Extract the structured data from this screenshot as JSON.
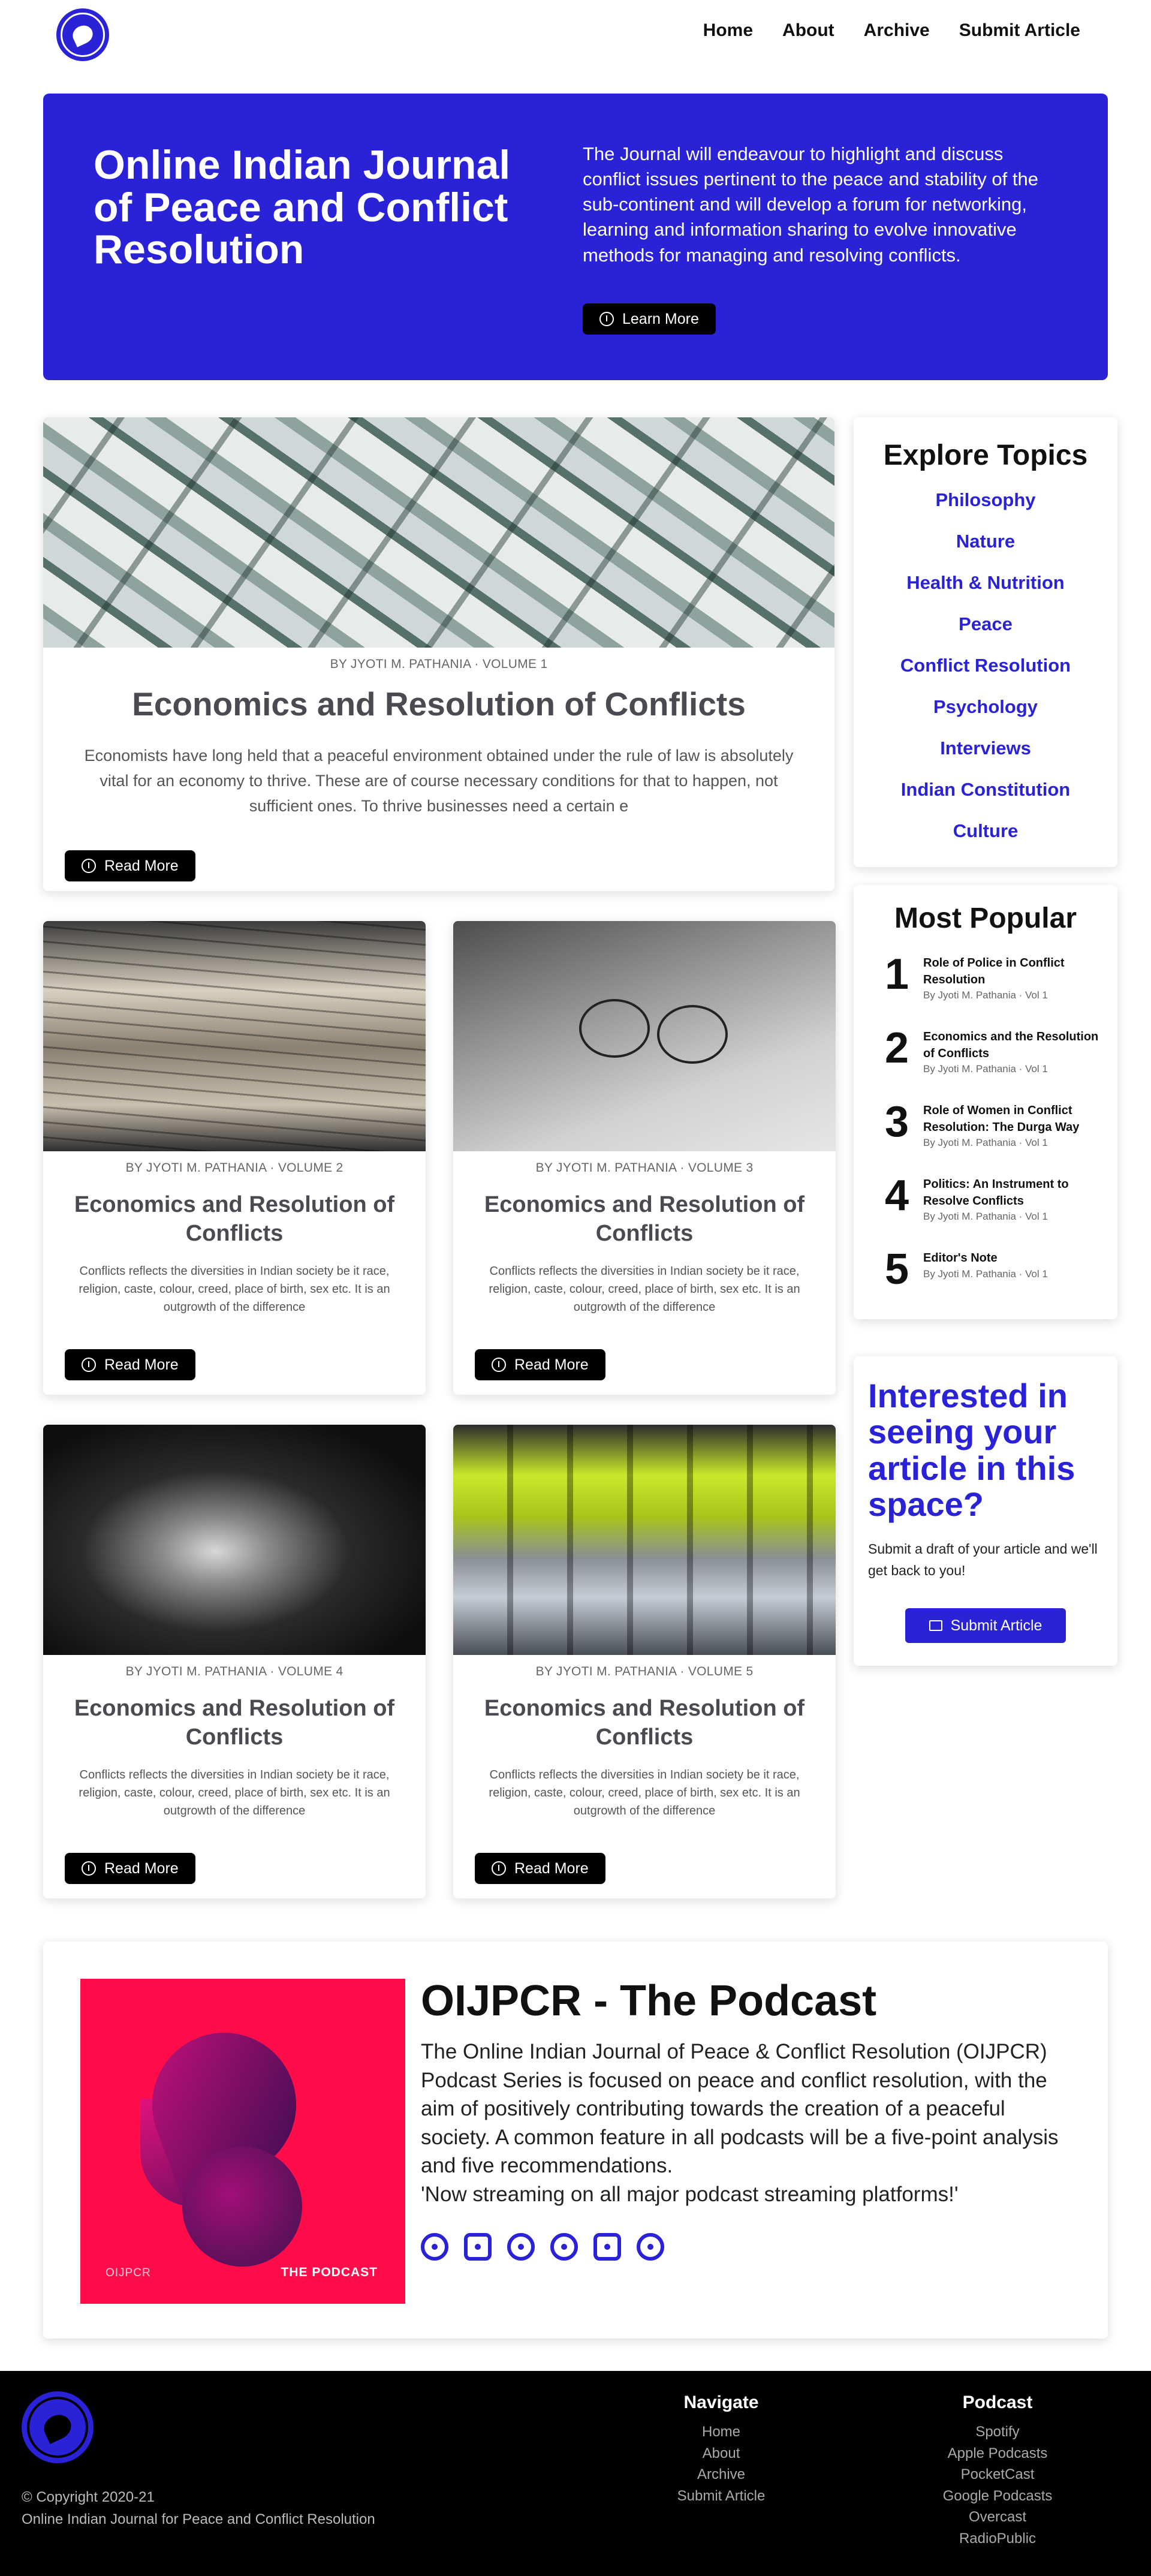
{
  "nav": {
    "items": [
      "Home",
      "About",
      "Archive",
      "Submit Article"
    ]
  },
  "hero": {
    "title": "Online Indian Journal of Peace and Conflict Resolution",
    "description": "The Journal will endeavour to highlight and discuss conflict issues pertinent to the peace and stability of the sub-continent and will develop a forum for networking, learning and information sharing to evolve innovative methods for managing and resolving conflicts.",
    "button": "Learn More"
  },
  "featured": {
    "byline": "BY JYOTI M. PATHANIA · VOLUME 1",
    "title": "Economics and Resolution of Conflicts",
    "excerpt": "Economists have long held that a peaceful environment obtained under the rule of law is absolutely vital for an economy to thrive. These are of course necessary conditions for that to happen, not sufficient ones. To thrive businesses need a certain e",
    "button": "Read More"
  },
  "cards": [
    {
      "byline": "BY JYOTI M. PATHANIA · VOLUME 2",
      "title": "Economics and Resolution of Conflicts",
      "excerpt": "Conflicts reflects the diversities in Indian society be it race, religion, caste, colour, creed, place of birth, sex etc. It is an outgrowth of the difference",
      "button": "Read More"
    },
    {
      "byline": "BY JYOTI M. PATHANIA · VOLUME 3",
      "title": "Economics and Resolution of Conflicts",
      "excerpt": "Conflicts reflects the diversities in Indian society be it race, religion, caste, colour, creed, place of birth, sex etc. It is an outgrowth of the difference",
      "button": "Read More"
    },
    {
      "byline": "BY JYOTI M. PATHANIA · VOLUME 4",
      "title": "Economics and Resolution of Conflicts",
      "excerpt": "Conflicts reflects the diversities in Indian society be it race, religion, caste, colour, creed, place of birth, sex etc. It is an outgrowth of the difference",
      "button": "Read More"
    },
    {
      "byline": "BY JYOTI M. PATHANIA · VOLUME 5",
      "title": "Economics and Resolution of Conflicts",
      "excerpt": "Conflicts reflects the diversities in Indian society be it race, religion, caste, colour, creed, place of birth, sex etc. It is an outgrowth of the difference",
      "button": "Read More"
    }
  ],
  "topics": {
    "title": "Explore Topics",
    "items": [
      "Philosophy",
      "Nature",
      "Health & Nutrition",
      "Peace",
      "Conflict Resolution",
      "Psychology",
      "Interviews",
      "Indian Constitution",
      "Culture"
    ]
  },
  "popular": {
    "title": "Most Popular",
    "items": [
      {
        "num": "1",
        "title": "Role of Police in Conflict Resolution",
        "meta": "By Jyoti M. Pathania · Vol 1"
      },
      {
        "num": "2",
        "title": "Economics and the Resolution of Conflicts",
        "meta": "By Jyoti M. Pathania · Vol 1"
      },
      {
        "num": "3",
        "title": "Role of Women in Conflict Resolution: The Durga Way",
        "meta": "By Jyoti M. Pathania · Vol 1"
      },
      {
        "num": "4",
        "title": "Politics: An Instrument to Resolve Conflicts",
        "meta": "By Jyoti M. Pathania · Vol 1"
      },
      {
        "num": "5",
        "title": "Editor's Note",
        "meta": "By Jyoti M. Pathania · Vol 1"
      }
    ]
  },
  "interest": {
    "title": "Interested in seeing your article in this space?",
    "text": "Submit a draft of your article and we'll get back to you!",
    "button": "Submit Article"
  },
  "podcast": {
    "title": "OIJPCR - The Podcast",
    "description": "The Online Indian Journal of Peace & Conflict Resolution (OIJPCR) Podcast Series is focused on peace and conflict resolution, with the aim of positively contributing towards the creation of a peaceful society. A common feature in all podcasts will be a five-point analysis and five recommendations.",
    "tagline": "'Now streaming on all major podcast streaming platforms!'",
    "art_left": "OIJPCR",
    "art_right": "THE PODCAST",
    "platform_icons": [
      "spotify-icon",
      "apple-podcasts-icon",
      "pocketcast-icon",
      "google-podcasts-icon",
      "radiopublic-icon",
      "overcast-icon"
    ]
  },
  "footer": {
    "copyright": "© Copyright 2020-21",
    "org": "Online Indian Journal for Peace and Conflict Resolution",
    "navigate_title": "Navigate",
    "navigate": [
      "Home",
      "About",
      "Archive",
      "Submit Article"
    ],
    "podcast_title": "Podcast",
    "podcast": [
      "Spotify",
      "Apple Podcasts",
      "PocketCast",
      "Google Podcasts",
      "Overcast",
      "RadioPublic"
    ]
  },
  "colors": {
    "accent": "#2a22d6",
    "podcast_art": "#ff0d4a"
  }
}
